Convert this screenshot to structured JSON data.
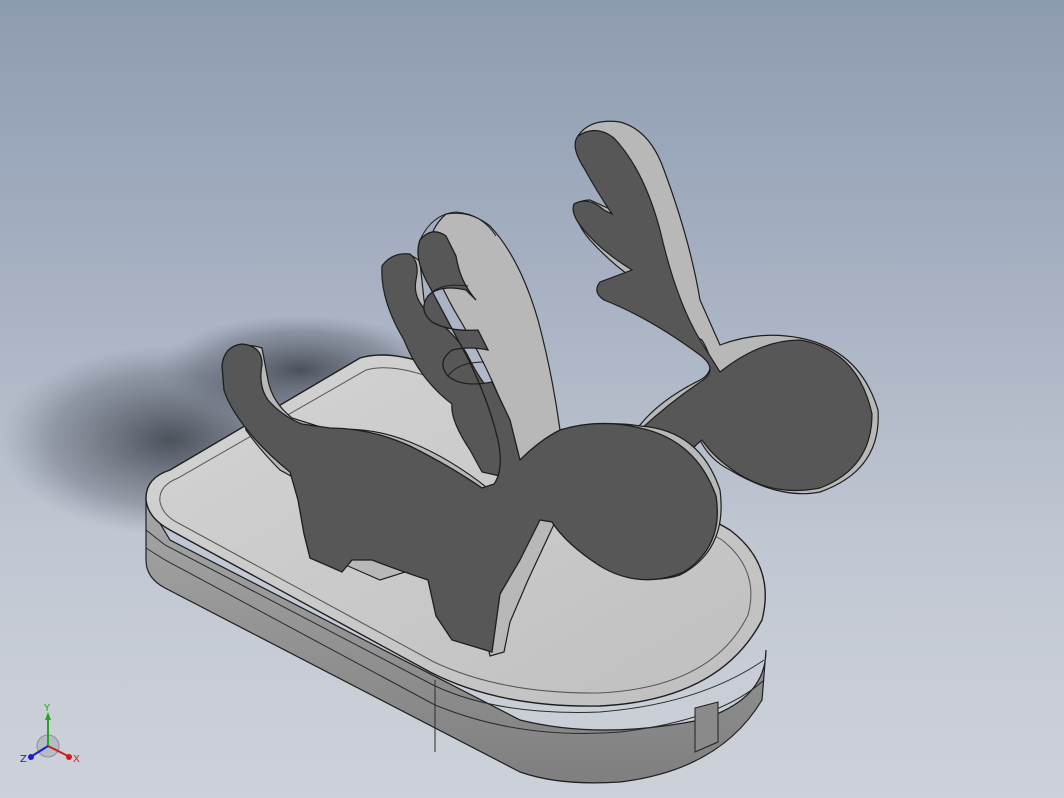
{
  "viewport": {
    "background_top": "#8d9bb1",
    "background_bottom": "#cdd1d9"
  },
  "model": {
    "part_fill": "#575757",
    "part_edge_fill": "#b9b9b9",
    "base_top_fill": "#c9c9c9",
    "base_side_fill": "#9a9a9a",
    "edge_color": "#1e1e1e"
  },
  "triad": {
    "x_label": "X",
    "y_label": "Y",
    "z_label": "Z",
    "x_color": "#d01c1c",
    "y_color": "#1fa81f",
    "z_color": "#1c1cd0"
  }
}
